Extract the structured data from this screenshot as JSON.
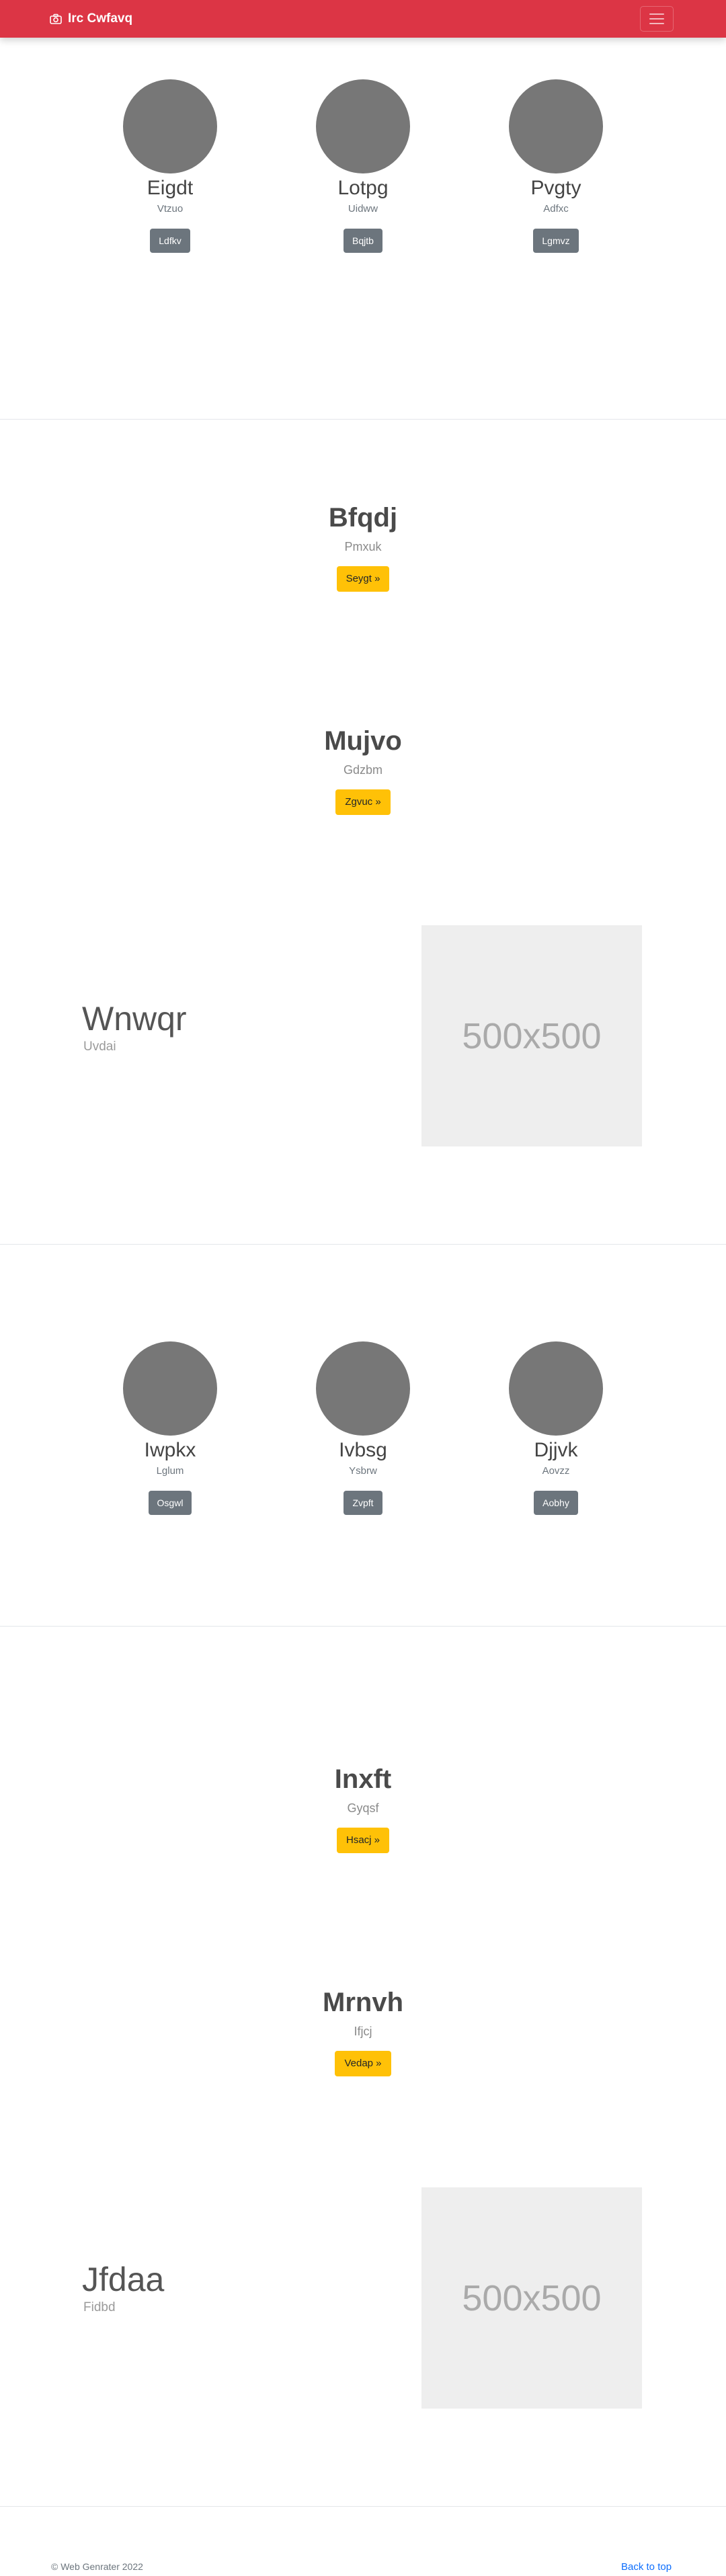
{
  "navbar": {
    "brand": "Irc Cwfavq",
    "brand_icon": "camera-icon",
    "menu_icon": "hamburger-menu-icon",
    "color": "#dc3545"
  },
  "team1": {
    "members": [
      {
        "name": "Eigdt",
        "role": "Vtzuo",
        "button": "Ldfkv"
      },
      {
        "name": "Lotpg",
        "role": "Uidww",
        "button": "Bqjtb"
      },
      {
        "name": "Pvgty",
        "role": "Adfxc",
        "button": "Lgmvz"
      }
    ]
  },
  "hero1": {
    "title": "Bfqdj",
    "subtitle": "Pmxuk",
    "button": "Seygt »"
  },
  "hero2": {
    "title": "Mujvo",
    "subtitle": "Gdzbm",
    "button": "Zgvuc »"
  },
  "feature1": {
    "title": "Wnwqr",
    "subtitle": "Uvdai",
    "image_label": "500x500"
  },
  "team2": {
    "members": [
      {
        "name": "Iwpkx",
        "role": "Lglum",
        "button": "Osgwl"
      },
      {
        "name": "Ivbsg",
        "role": "Ysbrw",
        "button": "Zvpft"
      },
      {
        "name": "Djjvk",
        "role": "Aovzz",
        "button": "Aobhy"
      }
    ]
  },
  "hero3": {
    "title": "Inxft",
    "subtitle": "Gyqsf",
    "button": "Hsacj »"
  },
  "hero4": {
    "title": "Mrnvh",
    "subtitle": "Ifjcj",
    "button": "Vedap »"
  },
  "feature2": {
    "title": "Jfdaa",
    "subtitle": "Fidbd",
    "image_label": "500x500"
  },
  "footer": {
    "copyright": "© Web Genrater 2022",
    "back_to_top": "Back to top"
  },
  "colors": {
    "primary_button": "#ffc107",
    "secondary_button": "#6c757d",
    "avatar": "#777777",
    "link": "#0d6efd"
  }
}
